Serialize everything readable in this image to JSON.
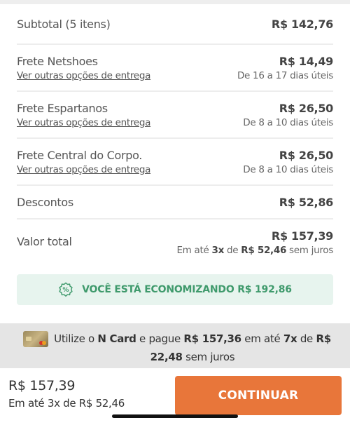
{
  "summary": {
    "subtotal": {
      "label": "Subtotal (5 itens)",
      "value": "R$ 142,76"
    },
    "fretes": [
      {
        "label": "Frete Netshoes",
        "link": "Ver outras opções de entrega",
        "value": "R$ 14,49",
        "eta": "De 16 a 17 dias úteis"
      },
      {
        "label": "Frete Espartanos",
        "link": "Ver outras opções de entrega",
        "value": "R$ 26,50",
        "eta": "De 8 a 10 dias úteis"
      },
      {
        "label": "Frete Central do Corpo.",
        "link": "Ver outras opções de entrega",
        "value": "R$ 26,50",
        "eta": "De 8 a 10 dias úteis"
      }
    ],
    "descontos": {
      "label": "Descontos",
      "value": "R$ 52,86"
    },
    "total": {
      "label": "Valor total",
      "value": "R$ 157,39",
      "inst_prefix": "Em até ",
      "inst_times": "3x",
      "inst_mid": " de ",
      "inst_amount": "R$ 52,46",
      "inst_suffix": " sem juros"
    }
  },
  "savings": {
    "icon": "percent-badge-icon",
    "text": "VOCÊ ESTÁ ECONOMIZANDO R$ 192,86"
  },
  "ncard": {
    "icon": "credit-card-icon",
    "t1": "Utilize o ",
    "card_name": "N Card",
    "t2": " e pague ",
    "amount": "R$ 157,36",
    "t3": " em até ",
    "times": "7x",
    "t4": " de ",
    "installment": "R$ 22,48",
    "t5": " sem juros"
  },
  "footer": {
    "total": "R$ 157,39",
    "installments": "Em até 3x de R$ 52,46",
    "button": "CONTINUAR"
  },
  "colors": {
    "accent": "#e8763a",
    "savings_green": "#3f9a6c",
    "savings_bg": "#e7f4ee"
  }
}
